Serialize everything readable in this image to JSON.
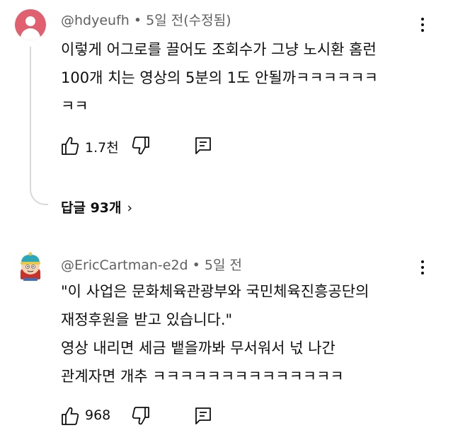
{
  "comments": [
    {
      "author": "@hdyeufh",
      "meta_separator": "•",
      "time": "5일 전(수정됨)",
      "lines": [
        "이렇게 어그로를 끌어도 조회수가 그냥 노시환 홈런",
        "100개 치는 영상의 5분의 1도 안될까ㅋㅋㅋㅋㅋㅋ",
        "ㅋㅋ"
      ],
      "like_count": "1.7천",
      "replies_label": "답글 93개",
      "replies_chevron": "›"
    },
    {
      "author": "@EricCartman-e2d",
      "meta_separator": "•",
      "time": "5일 전",
      "lines": [
        "\"이 사업은 문화체육관광부와 국민체육진흥공단의",
        "재정후원을 받고 있습니다.\"",
        "영상 내리면 세금 뱉을까봐 무서워서 넋 나간",
        "관계자면 개추 ㅋㅋㅋㅋㅋㅋㅋㅋㅋㅋㅋㅋㅋㅋ"
      ],
      "like_count": "968"
    }
  ],
  "colors": {
    "avatar1_bg": "#e0606f",
    "meta_text": "#606060",
    "thread_line": "#d9d9d9"
  },
  "icons": [
    "thumb-up-icon",
    "thumb-down-icon",
    "reply-icon",
    "more-vert-icon",
    "default-avatar-icon",
    "cartman-avatar-icon"
  ]
}
